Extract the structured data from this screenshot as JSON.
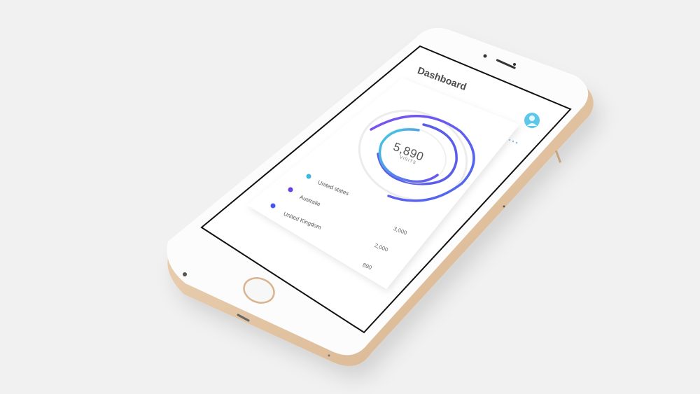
{
  "dashboard": {
    "title": "Dashboard",
    "visits_value": "5,890",
    "visits_label": "VISITS",
    "legend": [
      {
        "label": "United states",
        "value": "3,000",
        "color": "#3db8e0"
      },
      {
        "label": "Australie",
        "value": "2,000",
        "color": "#6a3fe6"
      },
      {
        "label": "United Kingdom",
        "value": "890",
        "color": "#4a55f0"
      }
    ]
  },
  "icons": {
    "avatar": "user-icon",
    "more": "more-dots-icon"
  },
  "colors": {
    "outer_ring": "#7b4ff0",
    "middle_ring": "#5a5de8",
    "inner_ring": "#3fc4e0",
    "phone_frame": "#e2c6a4",
    "avatar_bg": "#5bc7e9"
  }
}
